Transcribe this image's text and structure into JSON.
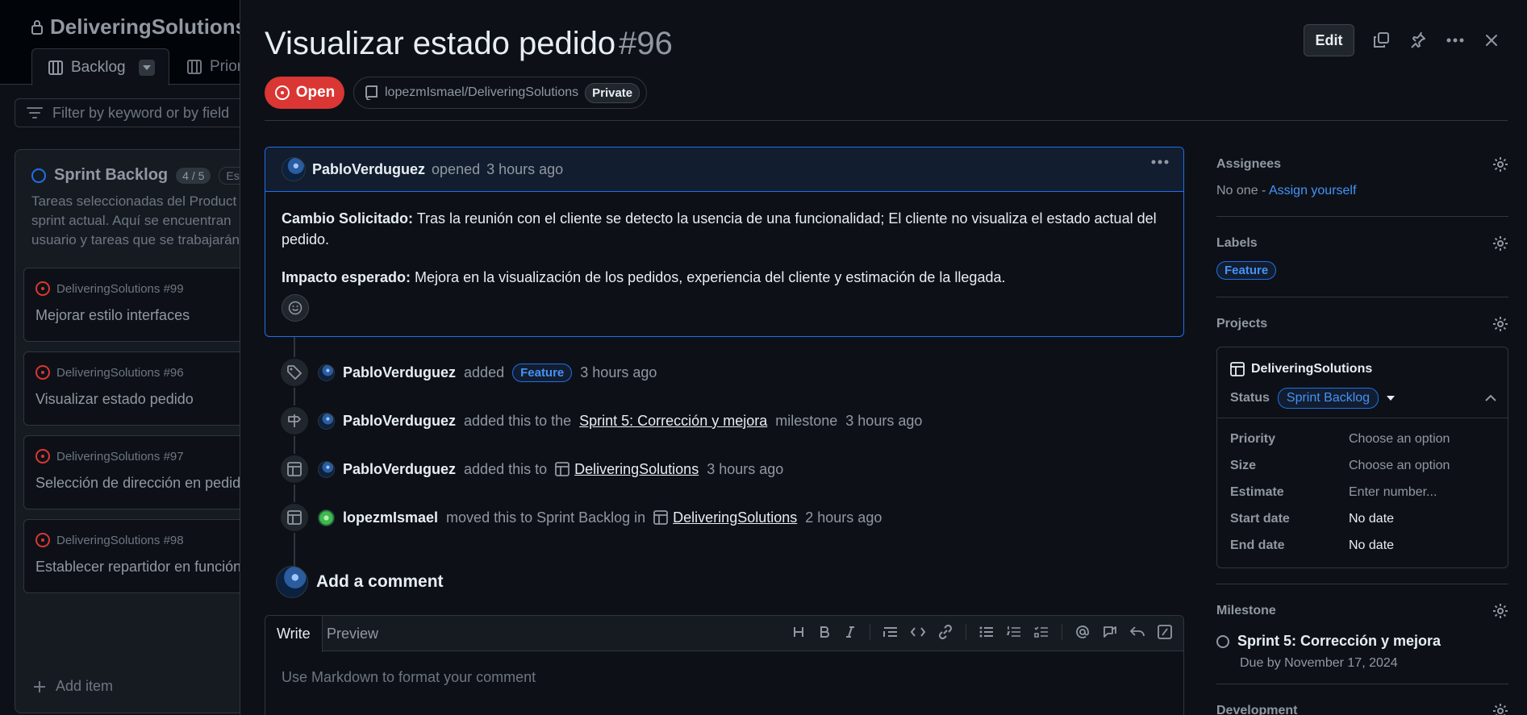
{
  "board": {
    "title": "DeliveringSolutions",
    "tabs": [
      {
        "label": "Backlog"
      },
      {
        "label": "Prior"
      }
    ],
    "filter_placeholder": "Filter by keyword or by field",
    "column": {
      "name": "Sprint Backlog",
      "count": "4 / 5",
      "estimate_badge": "Est",
      "description": "Tareas seleccionadas del Product sprint actual. Aquí se encuentran usuario y tareas que se trabajarán",
      "cards": [
        {
          "repo": "DeliveringSolutions #99",
          "title": "Mejorar estilo interfaces"
        },
        {
          "repo": "DeliveringSolutions #96",
          "title": "Visualizar estado pedido"
        },
        {
          "repo": "DeliveringSolutions #97",
          "title": "Selección de dirección en pedido"
        },
        {
          "repo": "DeliveringSolutions #98",
          "title": "Establecer repartidor en función"
        }
      ],
      "add_item": "Add item"
    }
  },
  "issue": {
    "title": "Visualizar estado pedido",
    "number": "#96",
    "edit_label": "Edit",
    "state": "Open",
    "repo": "lopezmIsmael/DeliveringSolutions",
    "visibility": "Private",
    "author": "PabloVerduguez",
    "opened_text": "opened",
    "opened_time": "3 hours ago",
    "body": {
      "p1_label": "Cambio Solicitado:",
      "p1_text": " Tras la reunión con el cliente se detecto la usencia de una funcionalidad; El cliente no visualiza el estado actual del pedido.",
      "p2_label": "Impacto esperado:",
      "p2_text": " Mejora en la visualización de los pedidos, experiencia del cliente y estimación de la llegada."
    }
  },
  "timeline": [
    {
      "actor": "PabloVerduguez",
      "pre": "added",
      "label": "Feature",
      "time": "3 hours ago"
    },
    {
      "actor": "PabloVerduguez",
      "pre": "added this to the",
      "link": "Sprint 5: Corrección y mejora",
      "post": "milestone",
      "time": "3 hours ago"
    },
    {
      "actor": "PabloVerduguez",
      "pre": "added this to",
      "link": "DeliveringSolutions",
      "time": "3 hours ago"
    },
    {
      "actor": "lopezmIsmael",
      "pre": "moved this to Sprint Backlog in",
      "link": "DeliveringSolutions",
      "time": "2 hours ago"
    }
  ],
  "comment_box": {
    "heading": "Add a comment",
    "tab_write": "Write",
    "tab_preview": "Preview",
    "placeholder": "Use Markdown to format your comment"
  },
  "sidebar": {
    "assignees": {
      "title": "Assignees",
      "none": "No one - ",
      "assign_link": "Assign yourself"
    },
    "labels": {
      "title": "Labels",
      "items": [
        "Feature"
      ]
    },
    "projects": {
      "title": "Projects",
      "project_name": "DeliveringSolutions",
      "status_label": "Status",
      "status_value": "Sprint Backlog",
      "fields": [
        {
          "name": "Priority",
          "value": "Choose an option"
        },
        {
          "name": "Size",
          "value": "Choose an option"
        },
        {
          "name": "Estimate",
          "value": "Enter number..."
        },
        {
          "name": "Start date",
          "value": "No date"
        },
        {
          "name": "End date",
          "value": "No date"
        }
      ]
    },
    "milestone": {
      "title": "Milestone",
      "name": "Sprint 5: Corrección y mejora",
      "due": "Due by November 17, 2024"
    },
    "development": {
      "title": "Development"
    }
  },
  "colors": {
    "open": "#da3633",
    "accent": "#4493f8",
    "bg": "#0d1117",
    "border": "#30363d"
  }
}
